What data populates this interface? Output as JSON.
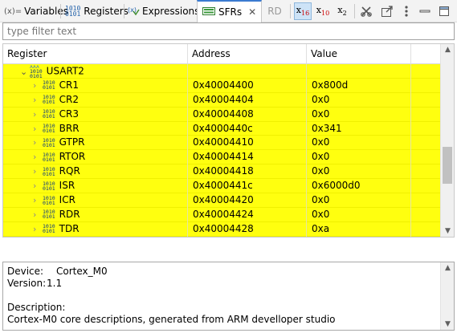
{
  "tabs": [
    {
      "label": "Variables",
      "icon": "variables-icon",
      "icon_text": "(x)="
    },
    {
      "label": "Registers",
      "icon": "registers-icon"
    },
    {
      "label": "Expressions",
      "icon": "expressions-icon"
    },
    {
      "label": "SFRs",
      "icon": "sfrs-icon",
      "active": true
    }
  ],
  "toolbar": {
    "rd_label": "RD",
    "fmt_hex": "x",
    "fmt_hex_sub": "16",
    "fmt_dec": "x",
    "fmt_dec_sub": "10",
    "fmt_bin": "x",
    "fmt_bin_sub": "2",
    "selected_format": "hex"
  },
  "filter": {
    "placeholder": "type filter text",
    "value": ""
  },
  "table": {
    "columns": [
      "Register",
      "Address",
      "Value"
    ],
    "peripheral": {
      "name": "USART2",
      "expanded": true
    },
    "rows": [
      {
        "name": "CR1",
        "address": "0x40004400",
        "value": "0x800d"
      },
      {
        "name": "CR2",
        "address": "0x40004404",
        "value": "0x0"
      },
      {
        "name": "CR3",
        "address": "0x40004408",
        "value": "0x0"
      },
      {
        "name": "BRR",
        "address": "0x4000440c",
        "value": "0x341"
      },
      {
        "name": "GTPR",
        "address": "0x40004410",
        "value": "0x0"
      },
      {
        "name": "RTOR",
        "address": "0x40004414",
        "value": "0x0"
      },
      {
        "name": "RQR",
        "address": "0x40004418",
        "value": "0x0"
      },
      {
        "name": "ISR",
        "address": "0x4000441c",
        "value": "0x6000d0"
      },
      {
        "name": "ICR",
        "address": "0x40004420",
        "value": "0x0"
      },
      {
        "name": "RDR",
        "address": "0x40004424",
        "value": "0x0"
      },
      {
        "name": "TDR",
        "address": "0x40004428",
        "value": "0xa"
      }
    ],
    "highlight_color": "#ffff0f"
  },
  "details": {
    "device_label": "Device:",
    "device_value": "Cortex_M0",
    "version_label": "Version:",
    "version_value": "1.1",
    "description_label": "Description:",
    "description_value": "Cortex-M0 core descriptions, generated from ARM develloper studio"
  }
}
